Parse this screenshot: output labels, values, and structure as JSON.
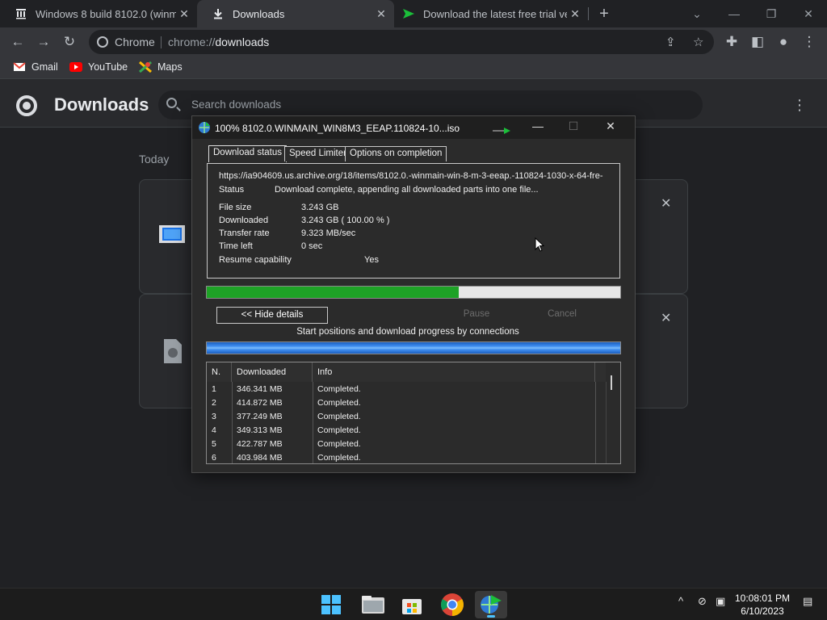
{
  "browser": {
    "tabs": [
      {
        "title": "Windows 8 build 8102.0 (winmain",
        "icon": "archive-icon"
      },
      {
        "title": "Downloads",
        "icon": "download-icon"
      },
      {
        "title": "Download the latest free trial ver",
        "icon": "idm-arrow-icon"
      }
    ],
    "omnibox": {
      "scheme": "Chrome",
      "url_prefix": "chrome://",
      "url_path": "downloads"
    },
    "bookmarks": [
      {
        "label": "Gmail",
        "color": "#ea4335"
      },
      {
        "label": "YouTube",
        "color": "#ff0000"
      },
      {
        "label": "Maps",
        "color": "#34a853"
      }
    ]
  },
  "downloads_page": {
    "title": "Downloads",
    "search_placeholder": "Search downloads",
    "group_label": "Today"
  },
  "idm": {
    "title": "100% 8102.0.WINMAIN_WIN8M3_EEAP.110824-10...iso",
    "tabs": [
      "Download status",
      "Speed Limiter",
      "Options on completion"
    ],
    "url": "https://ia904609.us.archive.org/18/items/8102.0.-winmain-win-8-m-3-eeap.-110824-1030-x-64-fre-",
    "status_label": "Status",
    "status_value": "Download complete, appending all downloaded parts into one file...",
    "file_size_label": "File size",
    "file_size_value": "3.243  GB",
    "downloaded_label": "Downloaded",
    "downloaded_value": "3.243  GB  ( 100.00 % )",
    "transfer_rate_label": "Transfer rate",
    "transfer_rate_value": "9.323  MB/sec",
    "time_left_label": "Time left",
    "time_left_value": "0 sec",
    "resume_label": "Resume capability",
    "resume_value": "Yes",
    "progress_fraction": 0.61,
    "progress_color": "#1ea226",
    "buttons": {
      "hide_details": "<< Hide details",
      "pause": "Pause",
      "cancel": "Cancel"
    },
    "connections_label": "Start positions and download progress by connections",
    "table_headers": [
      "N.",
      "Downloaded",
      "Info"
    ],
    "connections": [
      {
        "n": "1",
        "downloaded": "346.341  MB",
        "info": "Completed."
      },
      {
        "n": "2",
        "downloaded": "414.872  MB",
        "info": "Completed."
      },
      {
        "n": "3",
        "downloaded": "377.249  MB",
        "info": "Completed."
      },
      {
        "n": "4",
        "downloaded": "349.313  MB",
        "info": "Completed."
      },
      {
        "n": "5",
        "downloaded": "422.787  MB",
        "info": "Completed."
      },
      {
        "n": "6",
        "downloaded": "403.984  MB",
        "info": "Completed."
      }
    ]
  },
  "taskbar": {
    "time": "10:08:01 PM",
    "date": "6/10/2023",
    "accent": "#4cc2ff"
  }
}
